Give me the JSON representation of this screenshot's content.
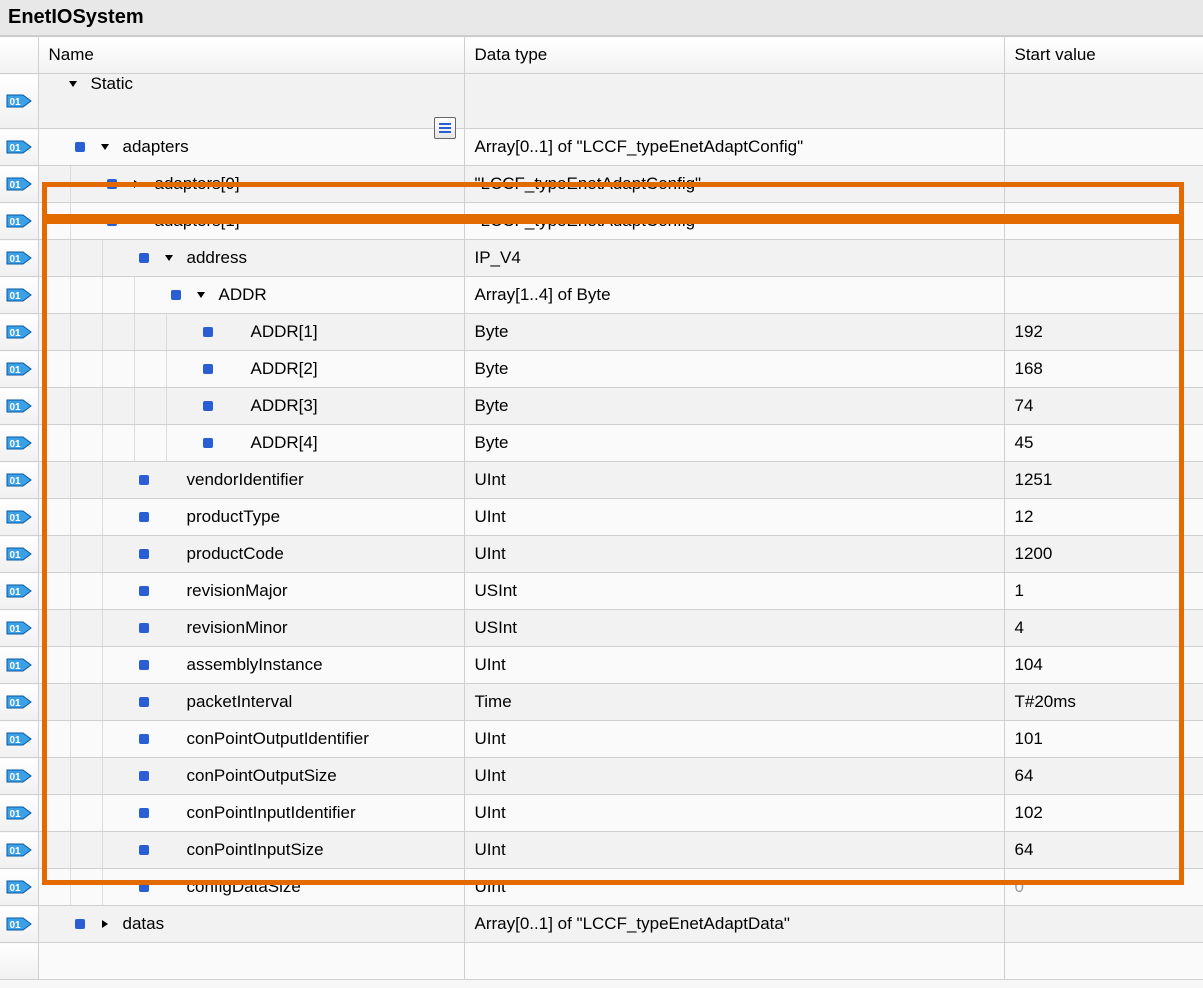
{
  "title": "EnetIOSystem",
  "columns": {
    "name": "Name",
    "type": "Data type",
    "start": "Start value"
  },
  "rows": [
    {
      "indent": 0,
      "bullet": false,
      "toggle": "down",
      "name": "Static",
      "type": "",
      "start": "",
      "detailBtn": true
    },
    {
      "indent": 1,
      "bullet": true,
      "toggle": "down",
      "name": "adapters",
      "type": "Array[0..1] of \"LCCF_typeEnetAdaptConfig\"",
      "start": ""
    },
    {
      "indent": 2,
      "bullet": true,
      "toggle": "right",
      "name": "adapters[0]",
      "type": "\"LCCF_typeEnetAdaptConfig\"",
      "start": ""
    },
    {
      "indent": 2,
      "bullet": true,
      "toggle": "down",
      "name": "adapters[1]",
      "type": "\"LCCF_typeEnetAdaptConfig\"",
      "start": ""
    },
    {
      "indent": 3,
      "bullet": true,
      "toggle": "down",
      "name": "address",
      "type": "IP_V4",
      "start": ""
    },
    {
      "indent": 4,
      "bullet": true,
      "toggle": "down",
      "name": "ADDR",
      "type": "Array[1..4] of Byte",
      "start": ""
    },
    {
      "indent": 5,
      "bullet": true,
      "toggle": "",
      "name": "ADDR[1]",
      "type": "Byte",
      "start": "192"
    },
    {
      "indent": 5,
      "bullet": true,
      "toggle": "",
      "name": "ADDR[2]",
      "type": "Byte",
      "start": "168"
    },
    {
      "indent": 5,
      "bullet": true,
      "toggle": "",
      "name": "ADDR[3]",
      "type": "Byte",
      "start": "74"
    },
    {
      "indent": 5,
      "bullet": true,
      "toggle": "",
      "name": "ADDR[4]",
      "type": "Byte",
      "start": "45"
    },
    {
      "indent": 3,
      "bullet": true,
      "toggle": "",
      "name": "vendorIdentifier",
      "type": "UInt",
      "start": "1251"
    },
    {
      "indent": 3,
      "bullet": true,
      "toggle": "",
      "name": "productType",
      "type": "UInt",
      "start": "12"
    },
    {
      "indent": 3,
      "bullet": true,
      "toggle": "",
      "name": "productCode",
      "type": "UInt",
      "start": "1200"
    },
    {
      "indent": 3,
      "bullet": true,
      "toggle": "",
      "name": "revisionMajor",
      "type": "USInt",
      "start": "1"
    },
    {
      "indent": 3,
      "bullet": true,
      "toggle": "",
      "name": "revisionMinor",
      "type": "USInt",
      "start": "4"
    },
    {
      "indent": 3,
      "bullet": true,
      "toggle": "",
      "name": "assemblyInstance",
      "type": "UInt",
      "start": "104"
    },
    {
      "indent": 3,
      "bullet": true,
      "toggle": "",
      "name": "packetInterval",
      "type": "Time",
      "start": "T#20ms"
    },
    {
      "indent": 3,
      "bullet": true,
      "toggle": "",
      "name": "conPointOutputIdentifier",
      "type": "UInt",
      "start": "101"
    },
    {
      "indent": 3,
      "bullet": true,
      "toggle": "",
      "name": "conPointOutputSize",
      "type": "UInt",
      "start": "64"
    },
    {
      "indent": 3,
      "bullet": true,
      "toggle": "",
      "name": "conPointInputIdentifier",
      "type": "UInt",
      "start": "102"
    },
    {
      "indent": 3,
      "bullet": true,
      "toggle": "",
      "name": "conPointInputSize",
      "type": "UInt",
      "start": "64"
    },
    {
      "indent": 3,
      "bullet": true,
      "toggle": "",
      "name": "configDataSize",
      "type": "UInt",
      "start": "0",
      "dimStart": true
    },
    {
      "indent": 1,
      "bullet": true,
      "toggle": "right",
      "name": "datas",
      "type": "Array[0..1] of \"LCCF_typeEnetAdaptData\"",
      "start": ""
    },
    {
      "indent": 0,
      "bullet": false,
      "toggle": "",
      "name": "",
      "type": "",
      "start": "",
      "noGutter": true
    }
  ],
  "highlight": {
    "startRow": 3,
    "endRow": 21
  }
}
